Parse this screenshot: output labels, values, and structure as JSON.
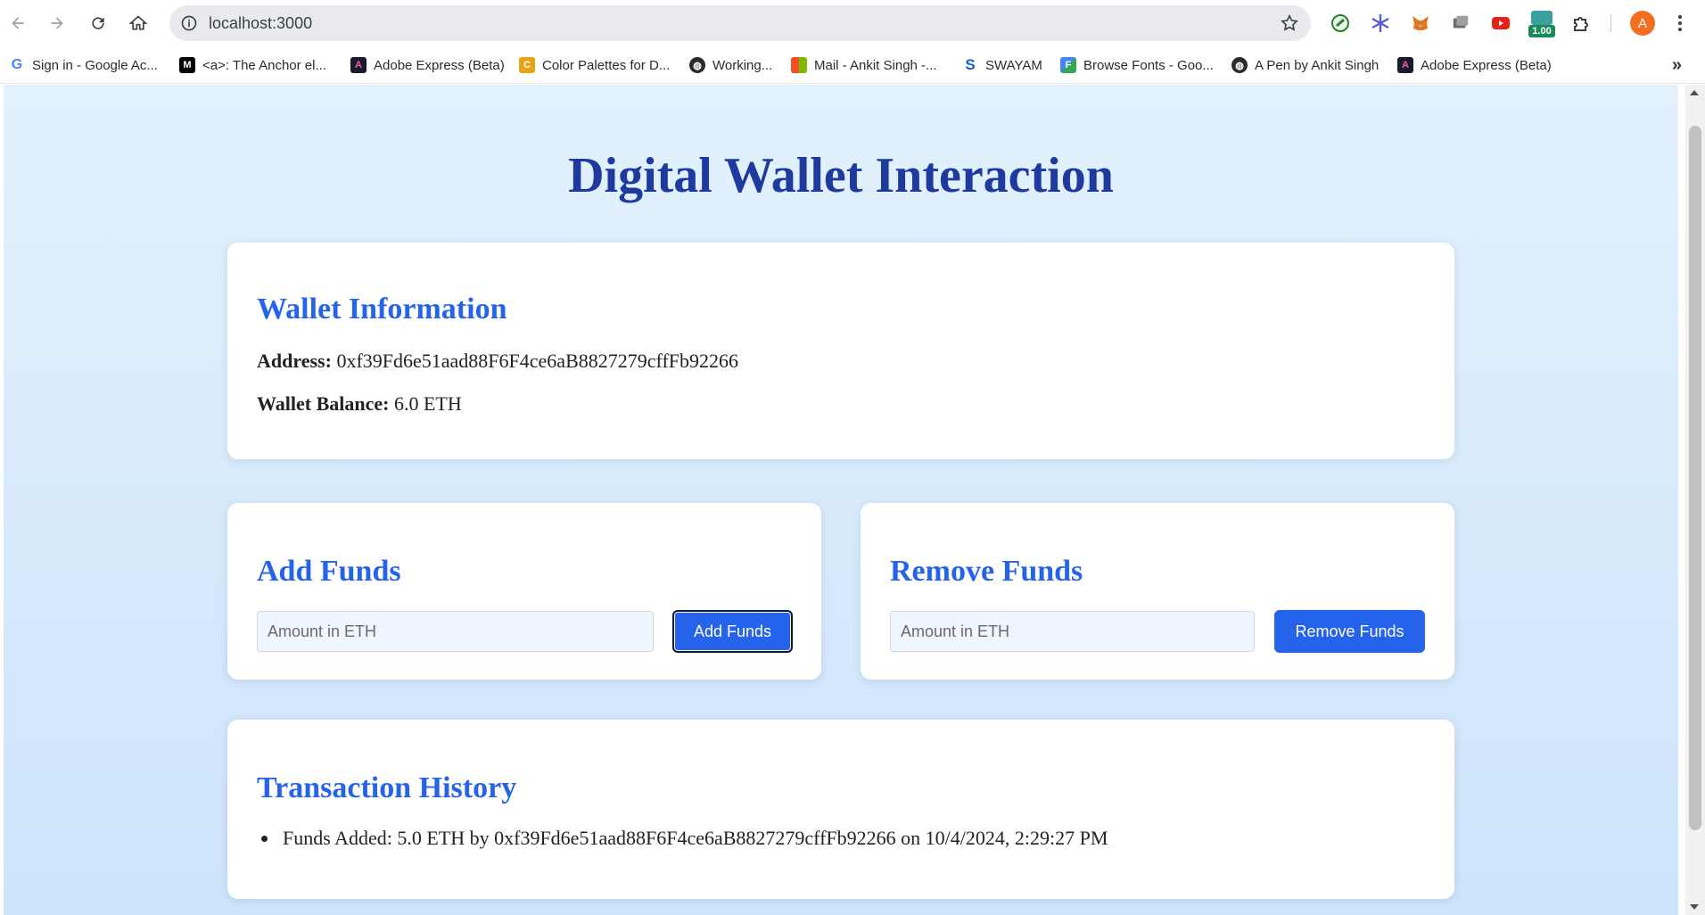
{
  "browser": {
    "url": "localhost:3000",
    "extensions": [
      {
        "icon": "google-lens-extension-icon",
        "color": "#2e7d32"
      },
      {
        "icon": "snowflake-extension-icon",
        "color": "#5b5bd6"
      },
      {
        "icon": "metamask-fox-icon",
        "color": "#e2761b"
      },
      {
        "icon": "gray-square-extension-icon",
        "color": "#6e6e6e"
      },
      {
        "icon": "youtube-extension-icon",
        "color": "#e62117"
      },
      {
        "icon": "video-speed-extension-icon",
        "color": "#1b8a5a",
        "badge": "1.00"
      },
      {
        "icon": "puzzle-extensions-icon",
        "color": "#3c4043"
      }
    ],
    "profile_initial": "A",
    "bookmarks": [
      {
        "label": "Sign in - Google Ac...",
        "icon": "google-g-icon",
        "color": "#4285f4",
        "glyph": "G"
      },
      {
        "label": "<a>: The Anchor el...",
        "icon": "mdn-icon",
        "color": "#000000",
        "glyph": "M"
      },
      {
        "label": "Adobe Express (Beta)",
        "icon": "adobe-express-icon",
        "color": "#1a1a2e",
        "glyph": "A"
      },
      {
        "label": "Color Palettes for D...",
        "icon": "coolors-icon",
        "color": "#e8a317",
        "glyph": "C"
      },
      {
        "label": "Working...",
        "icon": "globe-icon",
        "color": "#2b2b2b",
        "glyph": "◍"
      },
      {
        "label": "Mail - Ankit Singh -...",
        "icon": "microsoft-icon",
        "color": "#f25022",
        "glyph": "■"
      },
      {
        "label": "SWAYAM",
        "icon": "swayam-icon",
        "color": "#1565c0",
        "glyph": "S"
      },
      {
        "label": "Browse Fonts - Goo...",
        "icon": "google-fonts-icon",
        "color": "#34a853",
        "glyph": "F"
      },
      {
        "label": "A Pen by Ankit Singh",
        "icon": "globe-icon",
        "color": "#2b2b2b",
        "glyph": "◍"
      },
      {
        "label": "Adobe Express (Beta)",
        "icon": "adobe-express-icon",
        "color": "#1a1a2e",
        "glyph": "A"
      }
    ]
  },
  "page": {
    "title": "Digital Wallet Interaction",
    "wallet_info": {
      "heading": "Wallet Information",
      "address_label": "Address:",
      "address_value": "0xf39Fd6e51aad88F6F4ce6aB8827279cffFb92266",
      "balance_label": "Wallet Balance:",
      "balance_value": "6.0 ETH"
    },
    "add_funds": {
      "heading": "Add Funds",
      "input_placeholder": "Amount in ETH",
      "button_label": "Add Funds"
    },
    "remove_funds": {
      "heading": "Remove Funds",
      "input_placeholder": "Amount in ETH",
      "button_label": "Remove Funds"
    },
    "history": {
      "heading": "Transaction History",
      "items": [
        "Funds Added: 5.0 ETH by 0xf39Fd6e51aad88F6F4ce6aB8827279cffFb92266 on 10/4/2024, 2:29:27 PM"
      ]
    }
  },
  "colors": {
    "accent": "#2563eb",
    "title": "#1e3a9f",
    "background_top": "#e3f1fd",
    "background_bottom": "#cde4fb"
  }
}
